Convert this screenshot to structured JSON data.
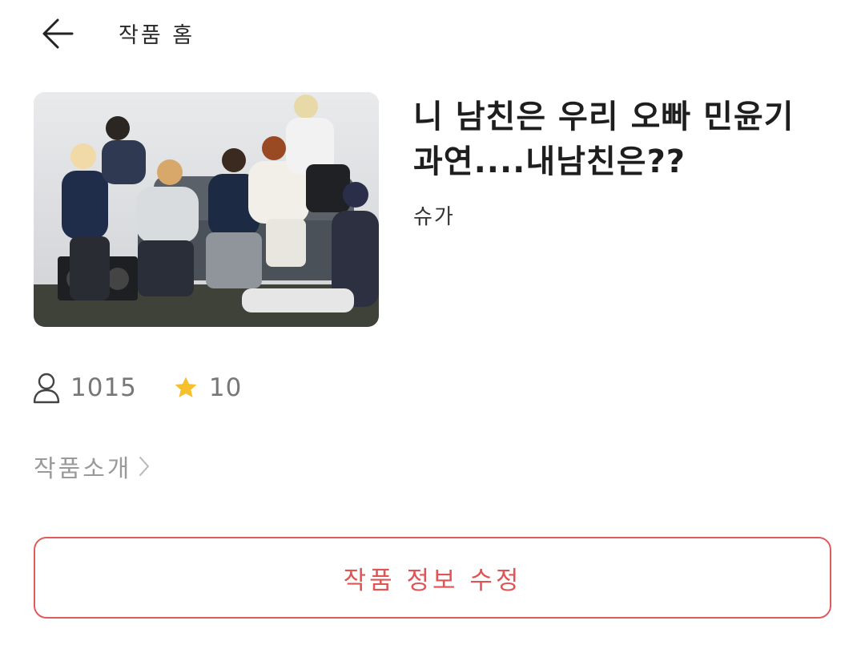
{
  "header": {
    "back_icon": "arrow-left-icon",
    "title": "작품 홈"
  },
  "work": {
    "cover_description_icon": "cover-image",
    "title": "니 남친은 우리 오빠 민윤기 과연....내남친은??",
    "author": "슈가"
  },
  "stats": {
    "views_icon": "user-icon",
    "views": "1015",
    "rating_icon": "star-icon",
    "rating": "10",
    "star_color": "#f5c02c"
  },
  "intro": {
    "label": "작품소개",
    "chevron_icon": "chevron-right-icon"
  },
  "actions": {
    "edit_label": "작품 정보 수정",
    "accent_color": "#e05c5c"
  }
}
